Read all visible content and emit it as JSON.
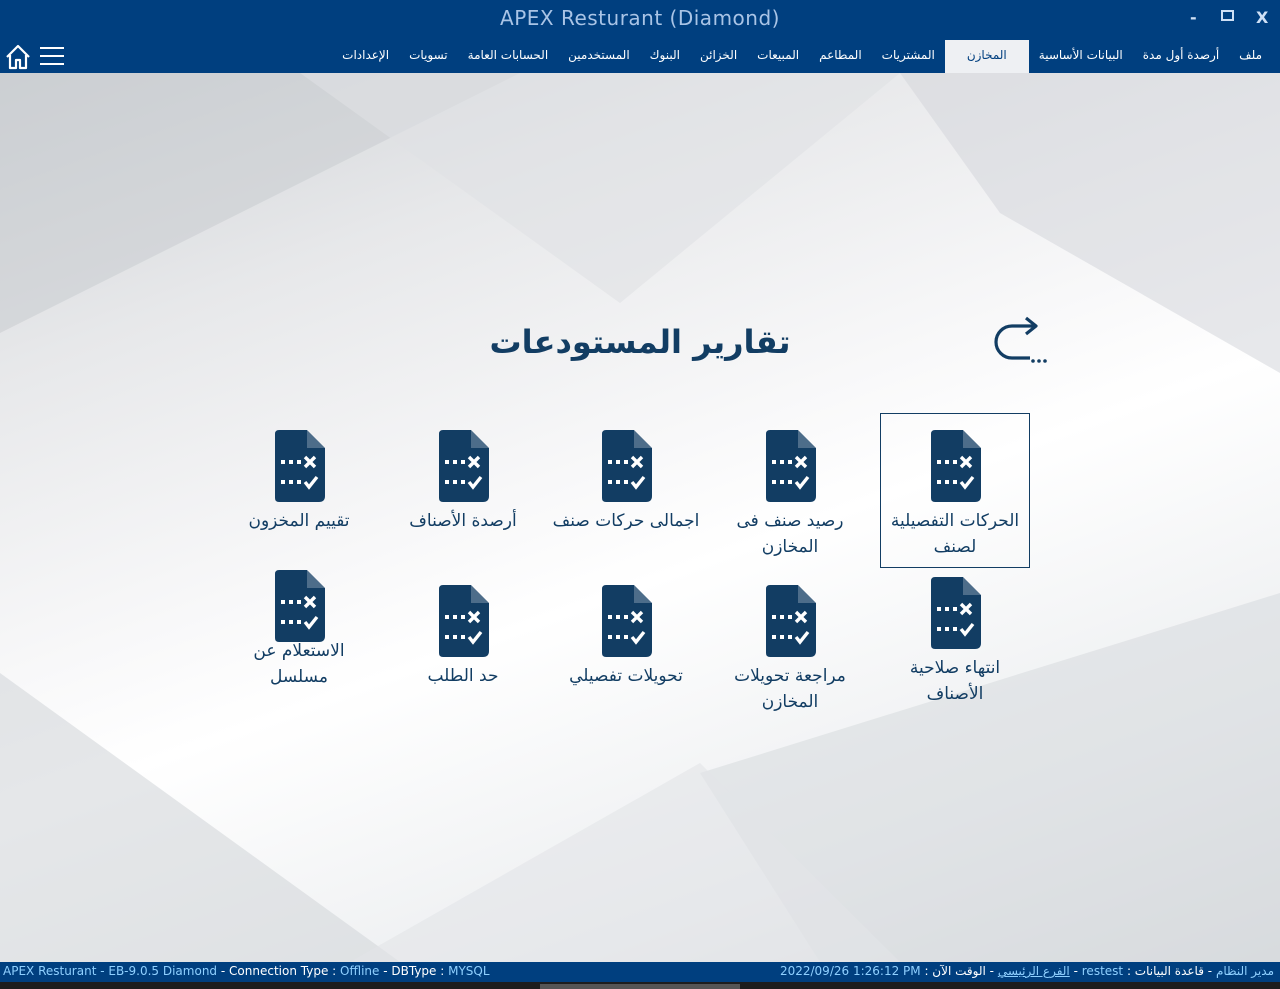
{
  "window": {
    "title": "APEX Resturant (Diamond)",
    "minimize": "-",
    "close": "X"
  },
  "menu": {
    "items": [
      {
        "label": "ملف"
      },
      {
        "label": "أرصدة أول مدة"
      },
      {
        "label": "البيانات الأساسية"
      },
      {
        "label": "المخازن",
        "active": true
      },
      {
        "label": "المشتريات"
      },
      {
        "label": "المطاعم"
      },
      {
        "label": "المبيعات"
      },
      {
        "label": "الخزائن"
      },
      {
        "label": "البنوك"
      },
      {
        "label": "المستخدمين"
      },
      {
        "label": "الحسابات العامة"
      },
      {
        "label": "تسويات"
      },
      {
        "label": "الإعدادات"
      }
    ],
    "icons": [
      "home-icon",
      "hamburger-menu-icon"
    ]
  },
  "page": {
    "title": "تقارير المستودعات",
    "back_icon": "return-arrow-icon"
  },
  "reports": {
    "row1": [
      {
        "label": "الحركات التفصيلية لصنف",
        "selected": true
      },
      {
        "label": "رصيد صنف فى المخازن"
      },
      {
        "label": "اجمالى حركات صنف"
      },
      {
        "label": "أرصدة الأصناف"
      },
      {
        "label": "تقييم المخزون"
      }
    ],
    "row2": [
      {
        "label": "انتهاء صلاحية الأصناف"
      },
      {
        "label": "مراجعة تحويلات المخازن"
      },
      {
        "label": "تحويلات تفصيلي"
      },
      {
        "label": "حد الطلب"
      },
      {
        "label": "الاستعلام عن مسلسل"
      }
    ],
    "icon": "report-document-icon"
  },
  "status": {
    "app": "APEX Resturant - EB-9.0.5  Diamond",
    "sep": "-",
    "connection_label": "Connection Type :",
    "connection_value": "Offline",
    "dbtype_label": "DBType :",
    "dbtype_value": "MYSQL",
    "user": "مدير النظام",
    "db_label": "قاعدة البيانات :",
    "db_value": "restest",
    "branch": "الفرع الرئيسي",
    "time_label": "الوقت الآن :",
    "time_value": "2022/09/26 1:26:12 PM"
  },
  "colors": {
    "primary": "#003f7f",
    "icon": "#123d63",
    "accent_text": "#8fd0ff"
  }
}
